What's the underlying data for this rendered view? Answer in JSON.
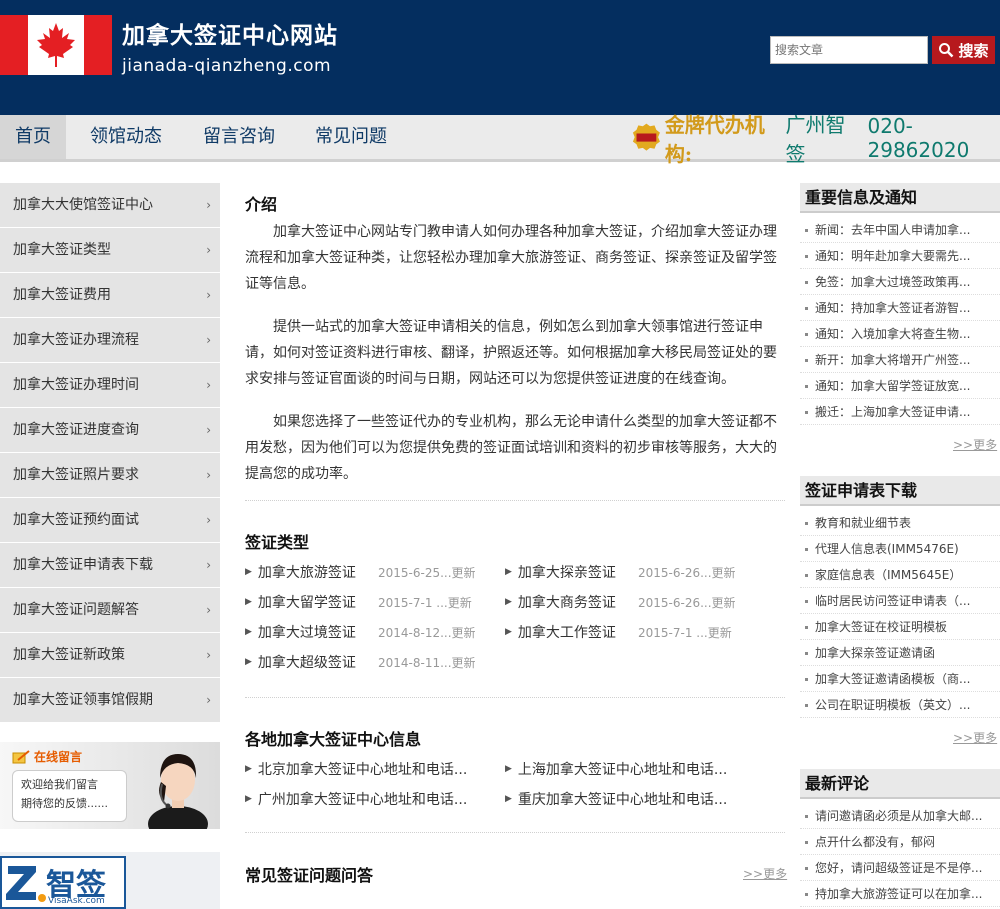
{
  "header": {
    "title": "加拿大签证中心网站",
    "domain": "jianada-qianzheng.com",
    "search_placeholder": "搜索文章",
    "search_button": "搜索"
  },
  "nav": {
    "items": [
      "首页",
      "领馆动态",
      "留言咨询",
      "常见问题"
    ],
    "hotline_label": "金牌代办机构:",
    "hotline_org": "广州智签",
    "hotline_phone": "020-29862020"
  },
  "side_menu": [
    "加拿大大使馆签证中心",
    "加拿大签证类型",
    "加拿大签证费用",
    "加拿大签证办理流程",
    "加拿大签证办理时间",
    "加拿大签证进度查询",
    "加拿大签证照片要求",
    "加拿大签证预约面试",
    "加拿大签证申请表下载",
    "加拿大签证问题解答",
    "加拿大签证新政策",
    "加拿大签证领事馆假期"
  ],
  "message_banner": {
    "tag": "在线留言",
    "line1": "欢迎给我们留言",
    "line2": "期待您的反馈......"
  },
  "logo_banner": {
    "brand": "智签",
    "url": "VisaAsk.com"
  },
  "intro": {
    "title": "介绍",
    "paragraphs": [
      "加拿大签证中心网站专门教申请人如何办理各种加拿大签证，介绍加拿大签证办理流程和加拿大签证种类，让您轻松办理加拿大旅游签证、商务签证、探亲签证及留学签证等信息。",
      "提供一站式的加拿大签证申请相关的信息，例如怎么到加拿大领事馆进行签证申请，如何对签证资料进行审核、翻译，护照返还等。如何根据加拿大移民局签证处的要求安排与签证官面谈的时间与日期，网站还可以为您提供签证进度的在线查询。",
      "如果您选择了一些签证代办的专业机构，那么无论申请什么类型的加拿大签证都不用发愁，因为他们可以为您提供免费的签证面试培训和资料的初步审核等服务，大大的提高您的成功率。"
    ]
  },
  "visa_types": {
    "title": "签证类型",
    "items": [
      {
        "name": "加拿大旅游签证",
        "date": "2015-6-25...更新"
      },
      {
        "name": "加拿大探亲签证",
        "date": "2015-6-26...更新"
      },
      {
        "name": "加拿大留学签证",
        "date": "2015-7-1 ...更新"
      },
      {
        "name": "加拿大商务签证",
        "date": "2015-6-26...更新"
      },
      {
        "name": "加拿大过境签证",
        "date": "2014-8-12...更新"
      },
      {
        "name": "加拿大工作签证",
        "date": "2015-7-1 ...更新"
      },
      {
        "name": "加拿大超级签证",
        "date": "2014-8-11...更新"
      }
    ]
  },
  "centers": {
    "title": "各地加拿大签证中心信息",
    "items": [
      "北京加拿大签证中心地址和电话...",
      "上海加拿大签证中心地址和电话...",
      "广州加拿大签证中心地址和电话...",
      "重庆加拿大签证中心地址和电话..."
    ]
  },
  "faq": {
    "title": "常见签证问题问答",
    "more": ">>更多"
  },
  "notices": {
    "title": "重要信息及通知",
    "items": [
      "新闻：去年中国人申请加拿...",
      "通知：明年赴加拿大要需先...",
      "免签：加拿大过境签政策再...",
      "通知：持加拿大签证者游智...",
      "通知：入境加拿大将查生物...",
      "新开：加拿大将增开广州签...",
      "通知：加拿大留学签证放宽...",
      "搬迁：上海加拿大签证申请..."
    ],
    "more": ">>更多"
  },
  "downloads": {
    "title": "签证申请表下载",
    "items": [
      "教育和就业细节表",
      "代理人信息表(IMM5476E)",
      "家庭信息表（IMM5645E）",
      "临时居民访问签证申请表（...",
      "加拿大签证在校证明模板",
      "加拿大探亲签证邀请函",
      "加拿大签证邀请函模板（商...",
      "公司在职证明模板（英文）..."
    ],
    "more": ">>更多"
  },
  "comments": {
    "title": "最新评论",
    "items": [
      "请问邀请函必须是从加拿大邮...",
      "点开什么都没有，郁闷",
      "您好，请问超级签证是不是停...",
      "持加拿大旅游签证可以在加拿..."
    ]
  },
  "colors": {
    "header_bg": "#042e5f",
    "flag_red": "#e41f23",
    "search_button": "#b7191d",
    "hotline_gold": "#d29a1b",
    "hotline_teal": "#0f7a6e"
  }
}
